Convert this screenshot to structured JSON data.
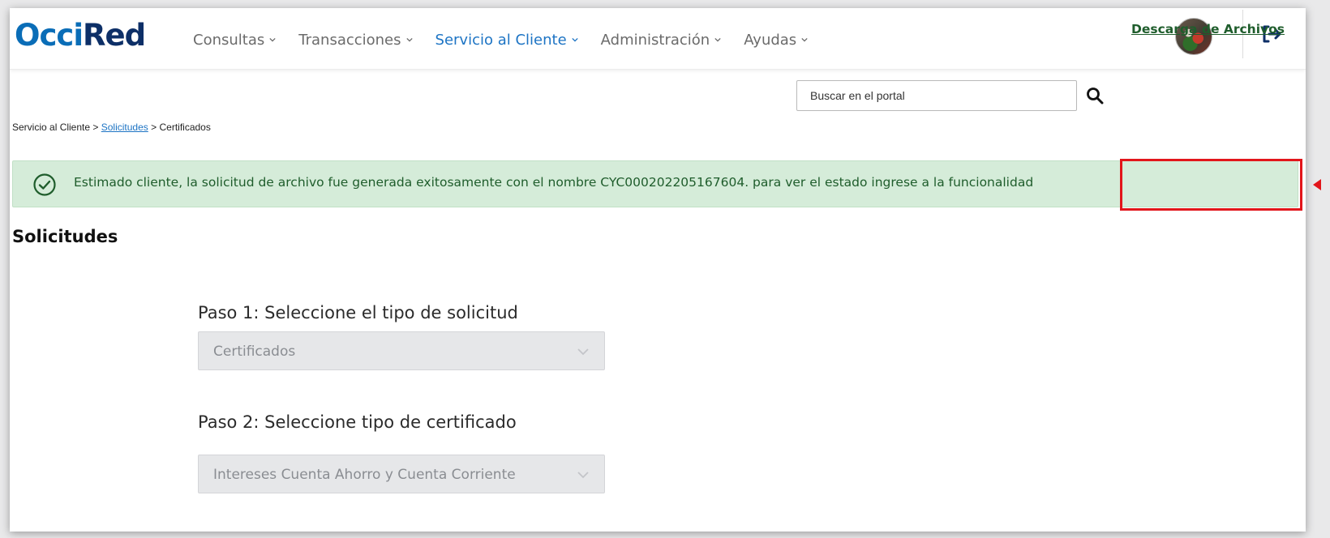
{
  "app": {
    "logo_part1": "Occi",
    "logo_part2": "Red"
  },
  "nav": {
    "items": [
      {
        "label": "Consultas",
        "active": false
      },
      {
        "label": "Transacciones",
        "active": false
      },
      {
        "label": "Servicio al Cliente",
        "active": true
      },
      {
        "label": "Administración",
        "active": false
      },
      {
        "label": "Ayudas",
        "active": false
      }
    ]
  },
  "search": {
    "placeholder": "Buscar en el portal"
  },
  "breadcrumb": {
    "root": "Servicio al Cliente",
    "sep1": ">",
    "middle": "Solicitudes",
    "sep2": ">",
    "current": "Certificados"
  },
  "alert": {
    "message": "Estimado cliente, la solicitud de archivo fue generada exitosamente con el nombre CYC000202205167604. para ver el estado ingrese a la funcionalidad",
    "link": "Descarga de Archivos"
  },
  "section": {
    "title": "Solicitudes"
  },
  "steps": [
    {
      "title": "Paso 1: Seleccione el tipo de solicitud",
      "value": "Certificados"
    },
    {
      "title": "Paso 2: Seleccione tipo de certificado",
      "value": "Intereses Cuenta Ahorro y Cuenta Corriente"
    }
  ],
  "colors": {
    "brand_light": "#0a6db7",
    "brand_dark": "#0d2f67",
    "nav_active": "#1d74c4",
    "alert_bg": "#d5ecd9",
    "alert_text": "#1f5d2c",
    "highlight": "#e2161b"
  },
  "icons": {
    "search": "search-icon",
    "success": "check-circle-icon",
    "logout": "logout-icon",
    "chevron": "chevron-down-icon"
  }
}
